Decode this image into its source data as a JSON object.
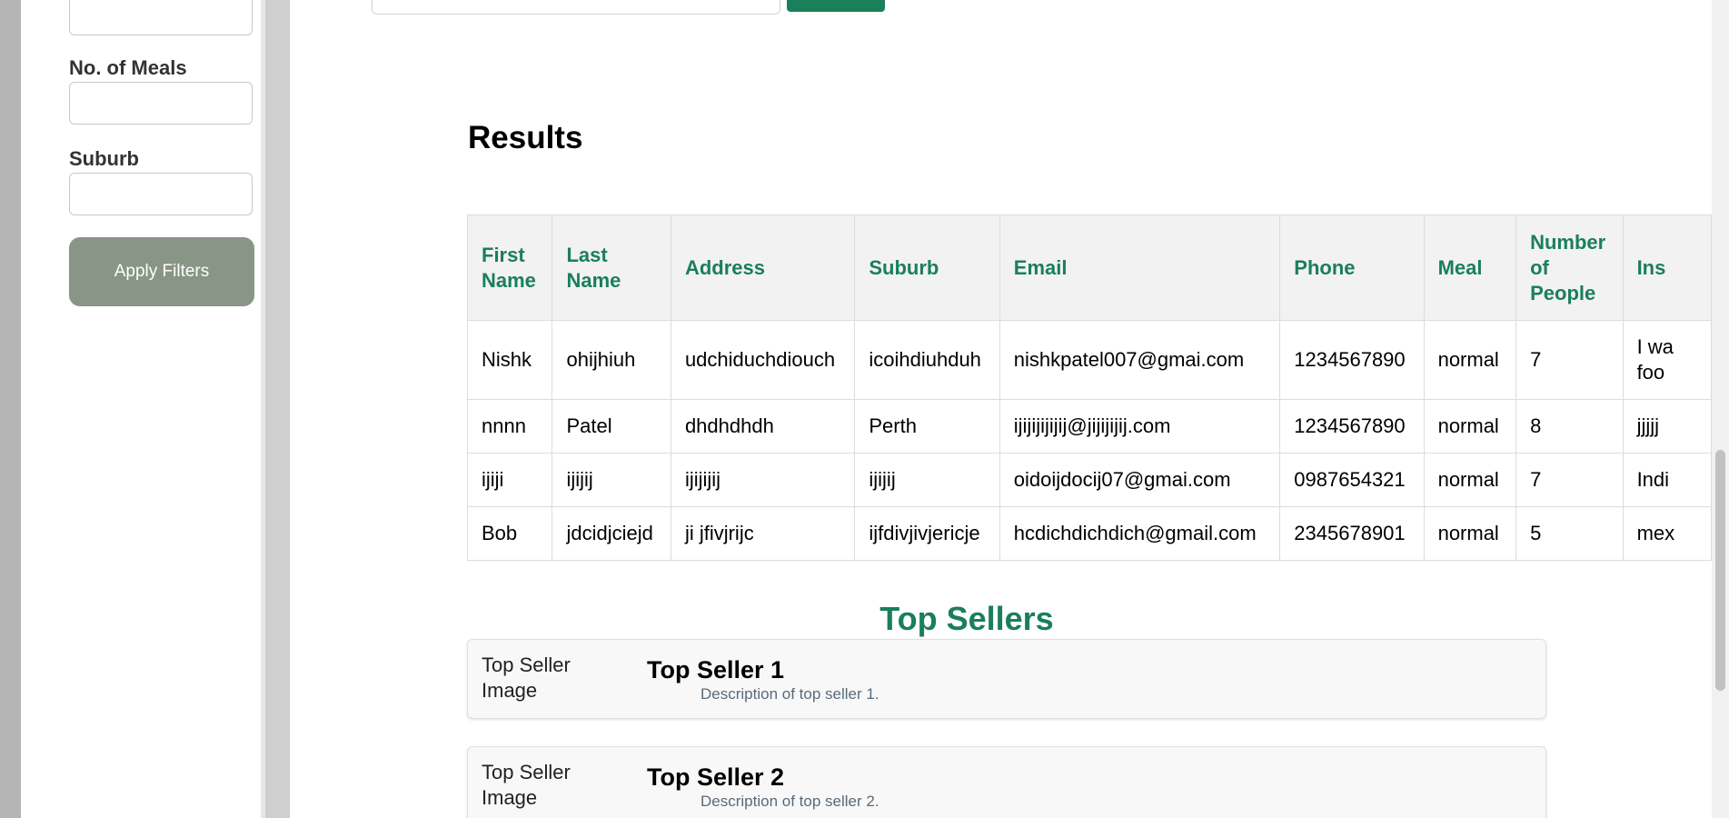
{
  "sidebar": {
    "meals_label": "No. of Meals",
    "suburb_label": "Suburb",
    "apply_button": "Apply Filters"
  },
  "results": {
    "title": "Results",
    "columns": [
      "First Name",
      "Last Name",
      "Address",
      "Suburb",
      "Email",
      "Phone",
      "Meal",
      "Number of People",
      "Ins"
    ],
    "rows": [
      [
        "Nishk",
        "ohijhiuh",
        "udchiduchdiouch",
        "icoihdiuhduh",
        "nishkpatel007@gmai.com",
        "1234567890",
        "normal",
        "7",
        "I wa\nfoo"
      ],
      [
        "nnnn",
        "Patel",
        "dhdhdhdh",
        "Perth",
        "ijijijijijij@jijijijij.com",
        "1234567890",
        "normal",
        "8",
        "jjjjj"
      ],
      [
        "ijiji",
        "ijijij",
        "ijijijij",
        "ijijij",
        "oidoijdocij07@gmai.com",
        "0987654321",
        "normal",
        "7",
        "Indi"
      ],
      [
        "Bob",
        "jdcidjciejd",
        "ji jfivjrijc",
        "ijfdivjivjericje",
        "hcdichdichdich@gmail.com",
        "2345678901",
        "normal",
        "5",
        "mex"
      ]
    ]
  },
  "top_sellers": {
    "title": "Top Sellers",
    "items": [
      {
        "image_alt": "Top Seller Image",
        "name": "Top Seller 1",
        "description": "Description of top seller 1."
      },
      {
        "image_alt": "Top Seller Image",
        "name": "Top Seller 2",
        "description": "Description of top seller 2."
      }
    ]
  },
  "colors": {
    "accent": "#1a7f5a",
    "apply_button": "#899587"
  }
}
